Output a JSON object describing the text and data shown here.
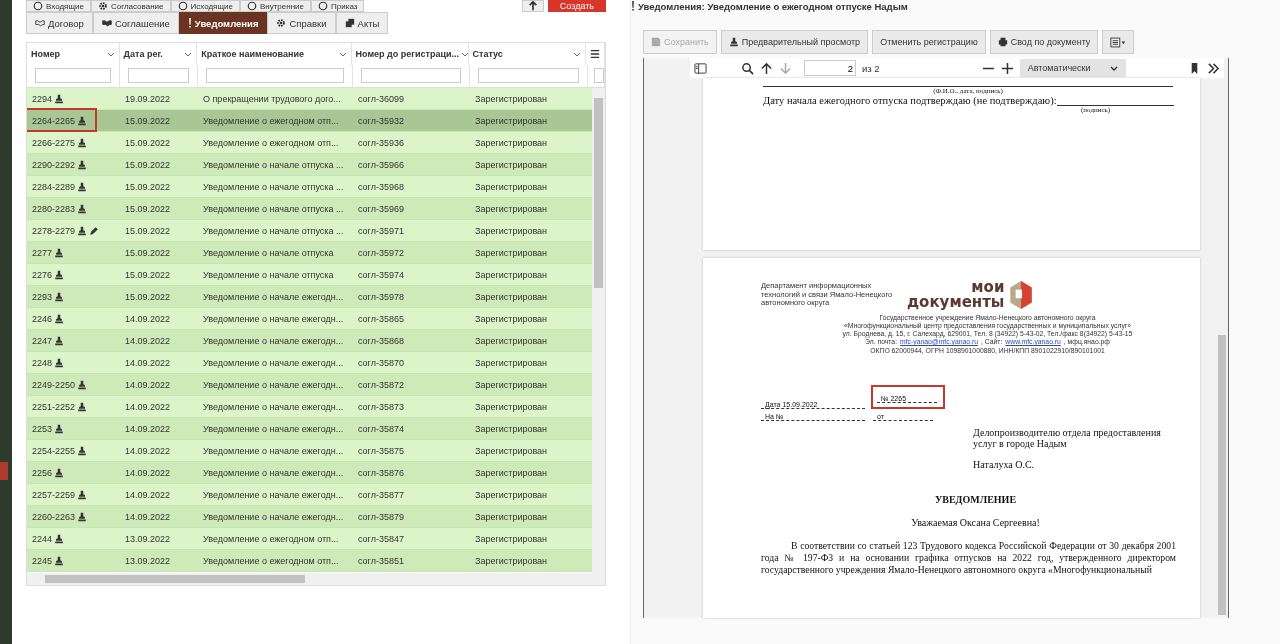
{
  "top_tabs": [
    {
      "label": "Входящие"
    },
    {
      "label": "Согласование"
    },
    {
      "label": "Исходящие"
    },
    {
      "label": "Внутренние"
    },
    {
      "label": "Приказ"
    }
  ],
  "create_button": {
    "label": "Создать"
  },
  "tabs": [
    {
      "label": "Договор",
      "selected": false
    },
    {
      "label": "Соглашение",
      "selected": false
    },
    {
      "label": "Уведомления",
      "selected": true
    },
    {
      "label": "Справки",
      "selected": false
    },
    {
      "label": "Акты",
      "selected": false
    }
  ],
  "table": {
    "columns": [
      "Номер",
      "Дата рег.",
      "Краткое наименование",
      "Номер до регистраци...",
      "Статус"
    ],
    "rows": [
      {
        "number": "2294",
        "kind": "stamped",
        "date": "19.09.2022",
        "name": "О прекращении трудового дого...",
        "pre_number": "согл-36099",
        "status": "Зарегистрирован",
        "selected": false,
        "highlighted": false
      },
      {
        "number": "2264-2265",
        "kind": "stamped",
        "date": "15.09.2022",
        "name": "Уведомление о ежегодном отп...",
        "pre_number": "согл-35932",
        "status": "Зарегистрирован",
        "selected": true,
        "highlighted": true
      },
      {
        "number": "2266-2275",
        "kind": "stamped",
        "date": "15.09.2022",
        "name": "Уведомление о ежегодном отп...",
        "pre_number": "согл-35936",
        "status": "Зарегистрирован",
        "selected": false,
        "highlighted": false
      },
      {
        "number": "2290-2292",
        "kind": "stamped",
        "date": "15.09.2022",
        "name": "Уведомление о начале отпуска ...",
        "pre_number": "согл-35966",
        "status": "Зарегистрирован",
        "selected": false,
        "highlighted": false
      },
      {
        "number": "2284-2289",
        "kind": "stamped",
        "date": "15.09.2022",
        "name": "Уведомление о начале отпуска ...",
        "pre_number": "согл-35968",
        "status": "Зарегистрирован",
        "selected": false,
        "highlighted": false
      },
      {
        "number": "2280-2283",
        "kind": "stamped",
        "date": "15.09.2022",
        "name": "Уведомление о начале отпуска ...",
        "pre_number": "согл-35969",
        "status": "Зарегистрирован",
        "selected": false,
        "highlighted": false
      },
      {
        "number": "2278-2279",
        "kind": "edited",
        "date": "15.09.2022",
        "name": "Уведомление о начале отпуска ...",
        "pre_number": "согл-35971",
        "status": "Зарегистрирован",
        "selected": false,
        "highlighted": false
      },
      {
        "number": "2277",
        "kind": "stamped",
        "date": "15.09.2022",
        "name": "Уведомление о начале отпуска",
        "pre_number": "согл-35972",
        "status": "Зарегистрирован",
        "selected": false,
        "highlighted": false
      },
      {
        "number": "2276",
        "kind": "stamped",
        "date": "15.09.2022",
        "name": "Уведомление о начале отпуска",
        "pre_number": "согл-35974",
        "status": "Зарегистрирован",
        "selected": false,
        "highlighted": false
      },
      {
        "number": "2293",
        "kind": "stamped",
        "date": "15.09.2022",
        "name": "Уведомление о начале ежегодн...",
        "pre_number": "согл-35978",
        "status": "Зарегистрирован",
        "selected": false,
        "highlighted": false
      },
      {
        "number": "2246",
        "kind": "stamped",
        "date": "14.09.2022",
        "name": "Уведомление о начале ежегодн...",
        "pre_number": "согл-35865",
        "status": "Зарегистрирован",
        "selected": false,
        "highlighted": false
      },
      {
        "number": "2247",
        "kind": "stamped",
        "date": "14.09.2022",
        "name": "Уведомление о начале ежегодн...",
        "pre_number": "согл-35868",
        "status": "Зарегистрирован",
        "selected": false,
        "highlighted": false
      },
      {
        "number": "2248",
        "kind": "stamped",
        "date": "14.09.2022",
        "name": "Уведомление о начале ежегодн...",
        "pre_number": "согл-35870",
        "status": "Зарегистрирован",
        "selected": false,
        "highlighted": false
      },
      {
        "number": "2249-2250",
        "kind": "stamped",
        "date": "14.09.2022",
        "name": "Уведомление о начале ежегодн...",
        "pre_number": "согл-35872",
        "status": "Зарегистрирован",
        "selected": false,
        "highlighted": false
      },
      {
        "number": "2251-2252",
        "kind": "stamped",
        "date": "14.09.2022",
        "name": "Уведомление о начале ежегодн...",
        "pre_number": "согл-35873",
        "status": "Зарегистрирован",
        "selected": false,
        "highlighted": false
      },
      {
        "number": "2253",
        "kind": "stamped",
        "date": "14.09.2022",
        "name": "Уведомление о начале ежегодн...",
        "pre_number": "согл-35874",
        "status": "Зарегистрирован",
        "selected": false,
        "highlighted": false
      },
      {
        "number": "2254-2255",
        "kind": "stamped",
        "date": "14.09.2022",
        "name": "Уведомление о начале ежегодн...",
        "pre_number": "согл-35875",
        "status": "Зарегистрирован",
        "selected": false,
        "highlighted": false
      },
      {
        "number": "2256",
        "kind": "stamped",
        "date": "14.09.2022",
        "name": "Уведомление о начале ежегодн...",
        "pre_number": "согл-35876",
        "status": "Зарегистрирован",
        "selected": false,
        "highlighted": false
      },
      {
        "number": "2257-2259",
        "kind": "stamped",
        "date": "14.09.2022",
        "name": "Уведомление о начале ежегодн...",
        "pre_number": "согл-35877",
        "status": "Зарегистрирован",
        "selected": false,
        "highlighted": false
      },
      {
        "number": "2260-2263",
        "kind": "stamped",
        "date": "14.09.2022",
        "name": "Уведомление о начале ежегодн...",
        "pre_number": "согл-35879",
        "status": "Зарегистрирован",
        "selected": false,
        "highlighted": false
      },
      {
        "number": "2244",
        "kind": "stamped",
        "date": "13.09.2022",
        "name": "Уведомление о ежегодном отп...",
        "pre_number": "согл-35847",
        "status": "Зарегистрирован",
        "selected": false,
        "highlighted": false
      },
      {
        "number": "2245",
        "kind": "stamped",
        "date": "13.09.2022",
        "name": "Уведомление о ежегодном отп...",
        "pre_number": "согл-35851",
        "status": "Зарегистрирован",
        "selected": false,
        "highlighted": false
      }
    ]
  },
  "document": {
    "title": "Уведомления: Уведомление о ежегодном отпуске Надым",
    "toolbar": [
      {
        "label": "Сохранить",
        "disabled": true
      },
      {
        "label": "Предварительный просмотр",
        "disabled": false
      },
      {
        "label": "Отменить регистрацию",
        "disabled": false
      },
      {
        "label": "Свод по документу",
        "disabled": false
      }
    ],
    "viewer": {
      "page_value": "2",
      "page_count": "из 2",
      "zoom": "Автоматически"
    },
    "page1": {
      "caption": "(Ф.И.О., дата, подпись)",
      "confirm": "Дату начала ежегодного отпуска подтверждаю (не подтверждаю):",
      "sign": "(подпись)"
    },
    "page2": {
      "department": "Департамент информационных технологий и связи Ямало-Ненецкого автономного округа",
      "logo_top": "мои",
      "logo_bottom": "документы",
      "org_lines": [
        "Государственное учреждение Ямало-Ненецкого автономного округа",
        "«Многофункциональный центр предоставления государственных и муниципальных услуг»",
        "ул. Броднева, д. 15, г. Салехард, 629001, Тел. 8 (34922) 5-43-02, Тел./факс 8(34922) 5-43-15"
      ],
      "email_label": "Эл. почта:",
      "email": "mfc-yanao@mfc.yanao.ru",
      "site_label": ", Сайт:",
      "site": "www.mfc.yanao.ru",
      "site_tail": ", мфц.янао.рф",
      "codes": "ОКПО 62000944, ОГРН 1098901000880, ИНН/КПП 8901022910/890101001",
      "date_field": "Дата  15.09.2022",
      "number_field": "№  2265",
      "ref_field": "На №",
      "from_field": "от",
      "addressee": [
        "Делопроизводителю отдела предоставления услуг в городе Надым",
        "Наталуха О.С."
      ],
      "heading": "УВЕДОМЛЕНИЕ",
      "greeting": "Уважаемая Оксана Сергеевна!",
      "body": "В соответствии со статьей 123 Трудового кодекса Российской Федерации от 30 декабря 2001 года № 197-ФЗ и на основании графика отпусков на 2022 год, утвержденного директором государственного учреждения Ямало-Ненецкого автономного округа «Многофункциональный"
    }
  }
}
